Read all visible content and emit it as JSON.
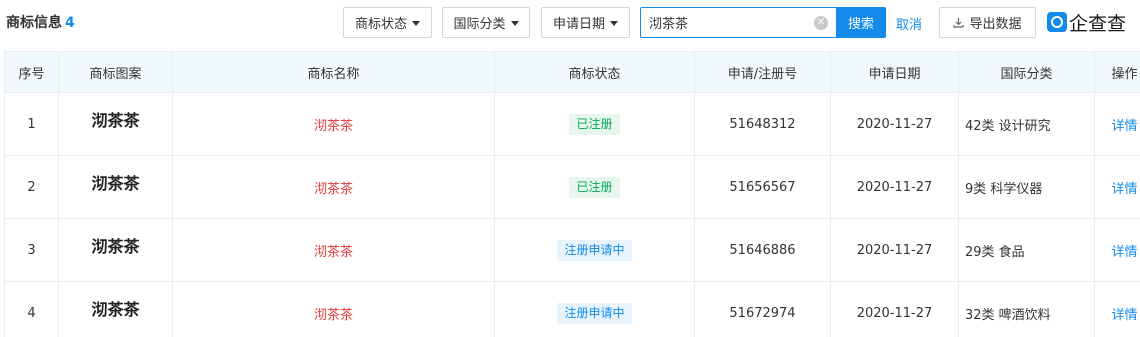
{
  "header": {
    "title": "商标信息",
    "count": "4"
  },
  "filters": {
    "status_label": "商标状态",
    "intl_class_label": "国际分类",
    "apply_date_label": "申请日期"
  },
  "search": {
    "value": "沏茶茶",
    "clear_glyph": "✕",
    "button_label": "搜索",
    "cancel_label": "取消"
  },
  "export": {
    "label": "导出数据",
    "icon": "download-icon"
  },
  "brand": {
    "logo_text": "企查查"
  },
  "table": {
    "columns": [
      "序号",
      "商标图案",
      "商标名称",
      "商标状态",
      "申请/注册号",
      "申请日期",
      "国际分类",
      "操作"
    ],
    "rows": [
      {
        "index": "1",
        "pattern": "沏茶茶",
        "name": "沏茶茶",
        "status": "已注册",
        "status_tone": "green",
        "reg_no": "51648312",
        "date": "2020-11-27",
        "class": "42类 设计研究",
        "action": "详情"
      },
      {
        "index": "2",
        "pattern": "沏茶茶",
        "name": "沏茶茶",
        "status": "已注册",
        "status_tone": "green",
        "reg_no": "51656567",
        "date": "2020-11-27",
        "class": "9类 科学仪器",
        "action": "详情"
      },
      {
        "index": "3",
        "pattern": "沏茶茶",
        "name": "沏茶茶",
        "status": "注册申请中",
        "status_tone": "blue",
        "reg_no": "51646886",
        "date": "2020-11-27",
        "class": "29类 食品",
        "action": "详情"
      },
      {
        "index": "4",
        "pattern": "沏茶茶",
        "name": "沏茶茶",
        "status": "注册申请中",
        "status_tone": "blue",
        "reg_no": "51672974",
        "date": "2020-11-27",
        "class": "32类 啤酒饮料",
        "action": "详情"
      }
    ]
  },
  "colors": {
    "accent": "#128bed",
    "name_red": "#e4393c",
    "registered_green": "#00a854",
    "header_bg": "#f2f9fc"
  }
}
